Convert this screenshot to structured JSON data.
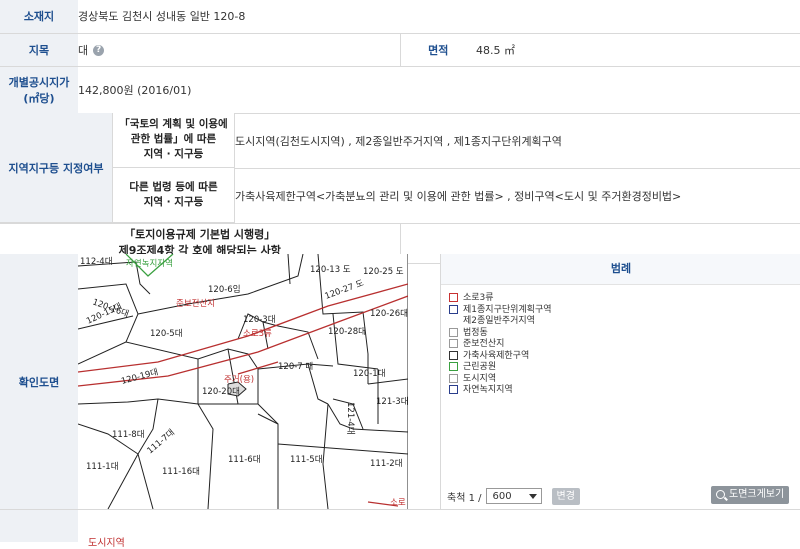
{
  "info": {
    "location_label": "소재지",
    "location_value": "경상북도 김천시 성내동 일반 120-8",
    "jimok_label": "지목",
    "jimok_value": "대",
    "area_label": "면적",
    "area_value": "48.5 ㎡",
    "price_label_1": "개별공시지가",
    "price_label_2": "(㎡당)",
    "price_value": "142,800원 (2016/01)"
  },
  "zoning": {
    "label": "지역지구등 지정여부",
    "row1_label_1": "「국토의 계획 및 이용에",
    "row1_label_2": "관한 법률」에 따른",
    "row1_label_3": "지역 · 지구등",
    "row1_value": "도시지역(김천도시지역) , 제2종일반주거지역 , 제1종지구단위계획구역",
    "row2_label_1": "다른 법령 등에 따른",
    "row2_label_2": "지역 · 지구등",
    "row2_value": "가축사육제한구역<가축분뇨의 관리 및 이용에 관한 법률> , 정비구역<도시 및 주거환경정비법>"
  },
  "regulation": {
    "label_1": "「토지이용규제 기본법 시행령」",
    "label_2": "제9조제4항 각 호에 해당되는 사항",
    "value": ""
  },
  "map": {
    "section_label": "확인도면",
    "labels": {
      "p112_4": "112-4대",
      "green_zone": "자연녹지지역",
      "p120_6": "120-6임",
      "p120_13": "120-13 도",
      "p120_25": "120-25 도",
      "p120_27": "120-27 도",
      "p120_26": "120-26대",
      "p120_28": "120-28대",
      "p120_16": "120-16대",
      "p120_15": "120-15대",
      "p120_5": "120-5대",
      "p120_3": "120-3대",
      "p120_7": "120-7 대",
      "p120_1": "120-1대",
      "p120_19": "120-19대",
      "p120_20": "120-20대",
      "p121_4": "121-4대",
      "p121_3": "121-3대",
      "p111_8": "111-8대",
      "p111_7": "111-7대",
      "p111_16": "111-16대",
      "p111_6": "111-6대",
      "p111_5": "111-5대",
      "p111_1": "111-1대",
      "p111_2": "111-2대",
      "cultural": "준보전산지",
      "soro": "소로3류",
      "target": "주거(용)",
      "soro_bottom": "소로"
    }
  },
  "legend": {
    "title": "범례",
    "items": [
      {
        "label": "소로3류",
        "color": "#c83232"
      },
      {
        "label": "제1종지구단위계획구역",
        "color": "#2a3e8c"
      },
      {
        "label": "제2종일반주거지역",
        "color": "",
        "sub": true
      },
      {
        "label": "법정동",
        "color": "#999999"
      },
      {
        "label": "준보전산지",
        "color": "#999999"
      },
      {
        "label": "가축사육제한구역",
        "color": "#333333"
      },
      {
        "label": "근린공원",
        "color": "#3aa040"
      },
      {
        "label": "도시지역",
        "color": "#999999"
      },
      {
        "label": "자연녹지지역",
        "color": "#2a3e8c"
      }
    ]
  },
  "scale": {
    "label": "축척 1 /",
    "value": "600",
    "change_button": "변경",
    "zoom_button": "도면크게보기"
  },
  "bottom": {
    "text": "도시지역"
  }
}
